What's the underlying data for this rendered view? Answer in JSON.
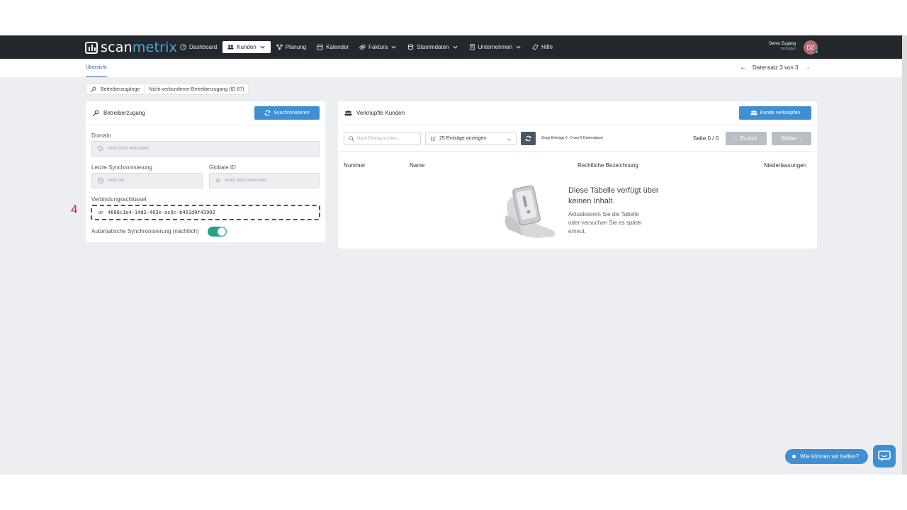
{
  "brand": {
    "logo_prefix": "scan",
    "logo_suffix": "metrix"
  },
  "nav": {
    "items": [
      {
        "label": "Dashboard",
        "icon": "gauge-icon"
      },
      {
        "label": "Kunden",
        "icon": "users-icon",
        "active": true,
        "dropdown": true
      },
      {
        "label": "Planung",
        "icon": "sitemap-icon"
      },
      {
        "label": "Kalender",
        "icon": "calendar-icon"
      },
      {
        "label": "Faktura",
        "icon": "coins-icon",
        "dropdown": true
      },
      {
        "label": "Stammdaten",
        "icon": "database-icon",
        "dropdown": true
      },
      {
        "label": "Unternehmen",
        "icon": "building-icon",
        "dropdown": true
      },
      {
        "label": "Hilfe",
        "icon": "life-ring-icon"
      }
    ],
    "user_name": "Demo Zugang",
    "user_status": "Verfügbar",
    "avatar_initials": "DZ"
  },
  "subnav": {
    "tab_label": "Übersicht",
    "record_label": "Datensatz 3 von 3"
  },
  "breadcrumb": {
    "item1": "Betreiberzugänge",
    "item2": "Nicht-verbundener Betreiberzugang (ID 67)"
  },
  "left_card": {
    "title": "Betreiberzugang",
    "sync_button": "Synchronisieren",
    "domain_label": "Domain",
    "domain_value": "Noch nicht verbunden",
    "last_sync_label": "Letzte Synchronisierung",
    "last_sync_value": "Noch nie",
    "global_id_label": "Globale ID",
    "global_id_value": "Noch nicht verbunden",
    "key_label": "Verbindungsschlüssel",
    "key_value": "4608c1e4-14d2-403e-ac0c-b451d0f43902",
    "auto_sync_label": "Automatische Synchronisierung (nächtlich)",
    "auto_sync_enabled": true
  },
  "annotation": {
    "step_number": "4",
    "color": "#cc1f1f"
  },
  "right_card": {
    "title": "Verknüpfte Kunden",
    "link_button": "Kunde verknüpfen",
    "search_placeholder": "Nach Eintrag suchen...",
    "entries_select": "25 Einträge anzeigen",
    "entries_info": "Zeige Einträge 0 - 0 von 0 Datensätzen",
    "page_info": "Seite 0 / 0",
    "prev_button": "Zurück",
    "next_button": "Weiter",
    "columns": [
      "Nummer",
      "Name",
      "Rechtliche Bezeichnung",
      "Niederlassungen"
    ],
    "empty_title_1": "Diese Tabelle verfügt über",
    "empty_title_2": "keinen Inhalt.",
    "empty_sub_1": "Aktualisieren Sie die Tabelle",
    "empty_sub_2": "oder versuchen Sie es später",
    "empty_sub_3": "erneut."
  },
  "help": {
    "label": "Wie können wir helfen?"
  },
  "colors": {
    "nav_bg": "#23272e",
    "primary": "#3f8fd2",
    "toggle_on": "#2aa18a",
    "page_bg": "#eceef2"
  }
}
